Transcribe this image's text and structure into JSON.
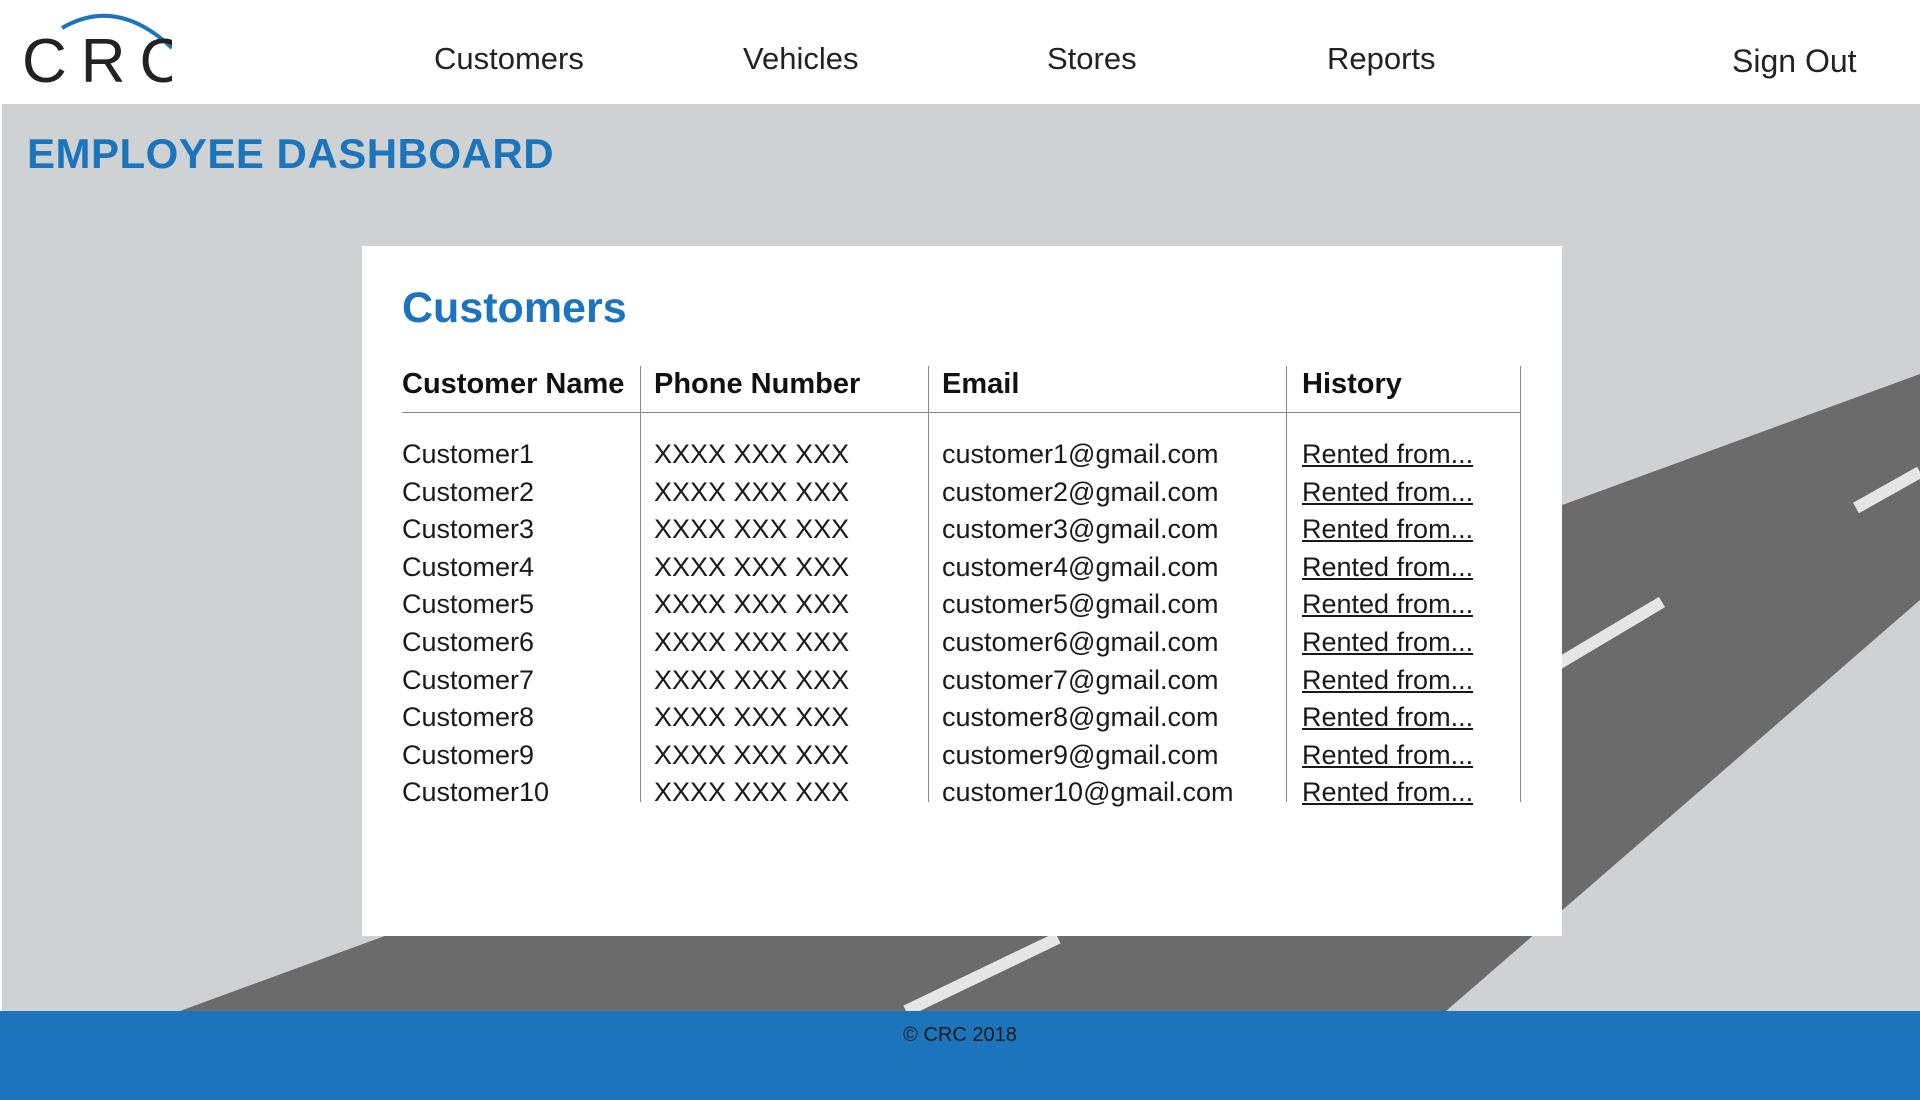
{
  "header": {
    "logo_text": "CRC",
    "nav": [
      "Customers",
      "Vehicles",
      "Stores",
      "Reports"
    ],
    "sign_out": "Sign Out"
  },
  "page": {
    "title": "EMPLOYEE DASHBOARD"
  },
  "card": {
    "title": "Customers",
    "columns": [
      "Customer Name",
      "Phone Number",
      "Email",
      "History"
    ],
    "rows": [
      [
        "Customer1",
        "XXXX XXX XXX",
        "customer1@gmail.com",
        "Rented from..."
      ],
      [
        "Customer2",
        "XXXX XXX XXX",
        "customer2@gmail.com",
        "Rented from..."
      ],
      [
        "Customer3",
        "XXXX XXX XXX",
        "customer3@gmail.com",
        "Rented from..."
      ],
      [
        "Customer4",
        "XXXX XXX XXX",
        "customer4@gmail.com",
        "Rented from..."
      ],
      [
        "Customer5",
        "XXXX XXX XXX",
        "customer5@gmail.com",
        "Rented from..."
      ],
      [
        "Customer6",
        "XXXX XXX XXX",
        "customer6@gmail.com",
        "Rented from..."
      ],
      [
        "Customer7",
        "XXXX XXX XXX",
        "customer7@gmail.com",
        "Rented from..."
      ],
      [
        "Customer8",
        "XXXX XXX XXX",
        "customer8@gmail.com",
        "Rented from..."
      ],
      [
        "Customer9",
        "XXXX XXX XXX",
        "customer9@gmail.com",
        "Rented from..."
      ],
      [
        "Customer10",
        "XXXX XXX XXX",
        "customer10@gmail.com",
        "Rented from..."
      ]
    ]
  },
  "footer": {
    "copyright": "© CRC 2018"
  },
  "colors": {
    "brand_blue": "#1c75bc",
    "page_bg": "#cfd2d3",
    "road": "#6b6b6b",
    "lane_marking": "#e6e6e6"
  }
}
